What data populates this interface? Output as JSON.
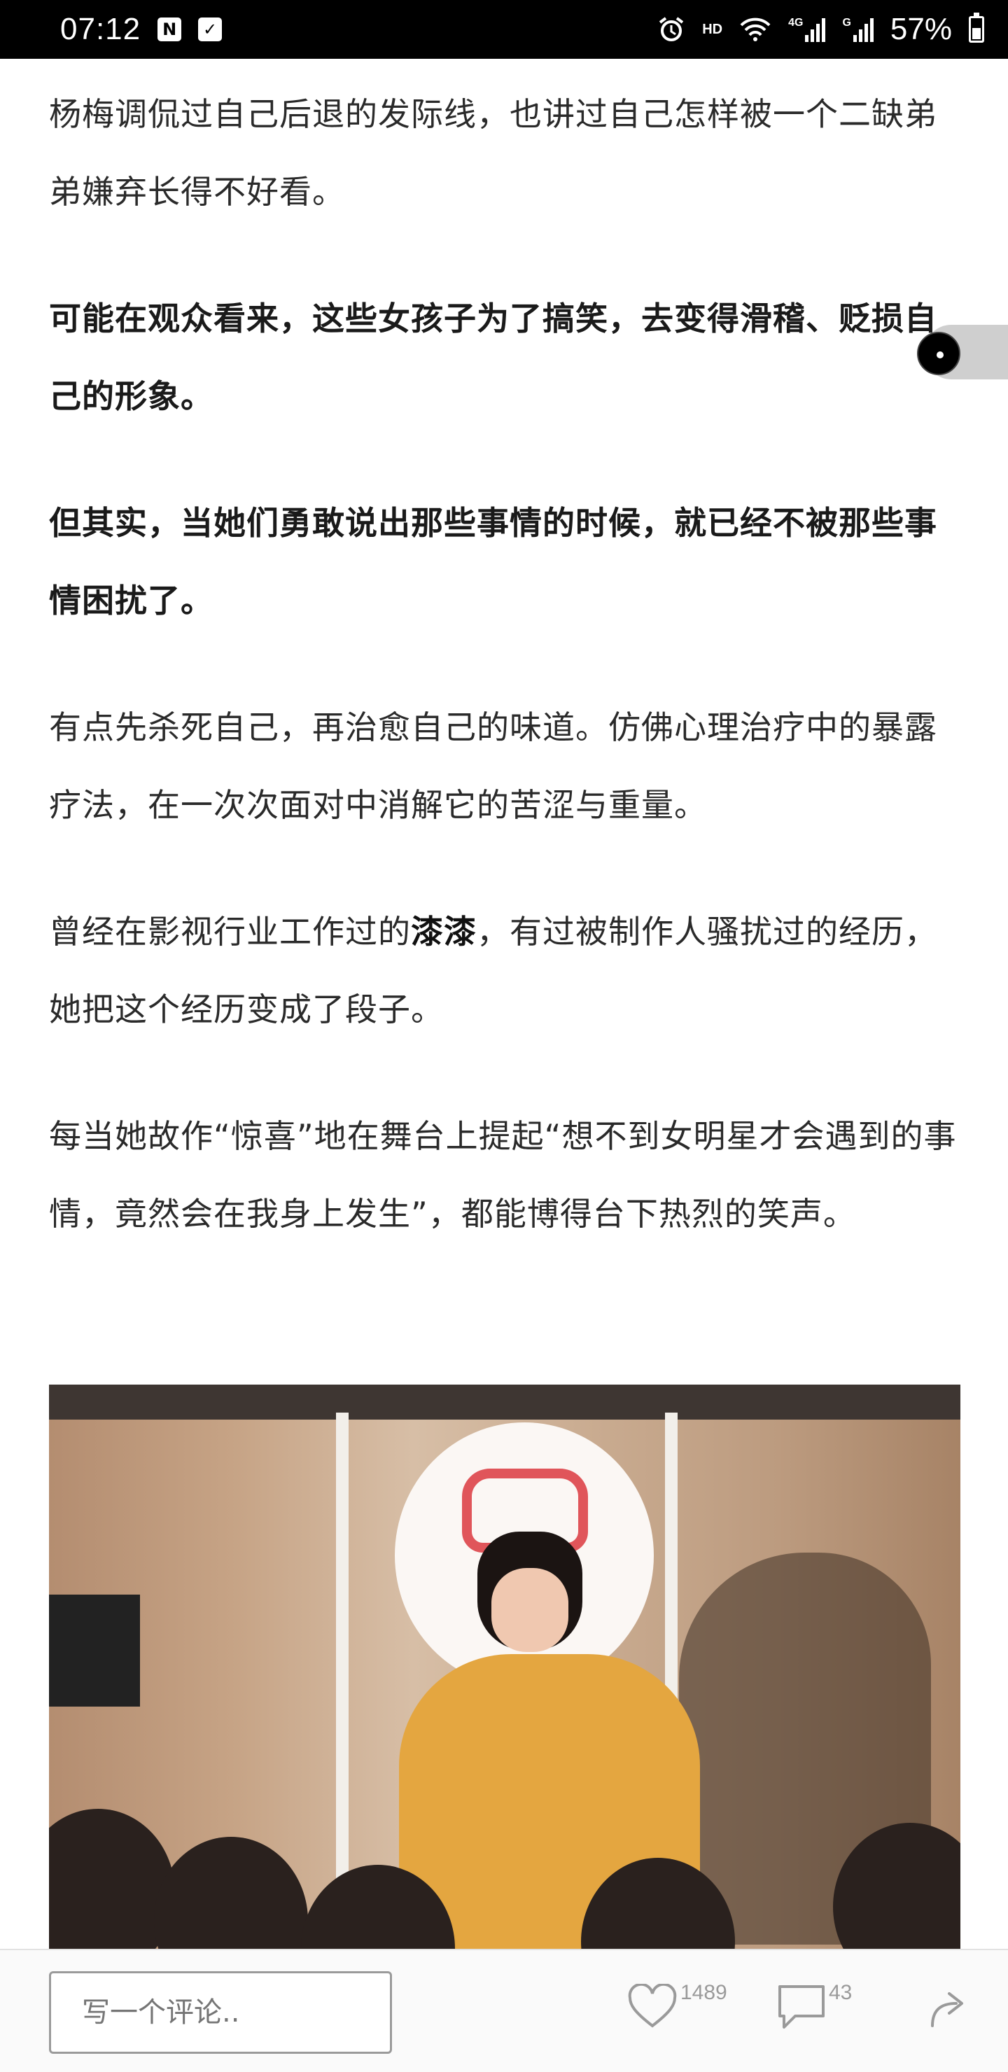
{
  "status_bar": {
    "time": "07:12",
    "left_icons": [
      "n-notification-icon",
      "check-notification-icon"
    ],
    "hd_label": "HD",
    "net_4g_label": "4G",
    "net_g_label": "G",
    "battery_text": "57%",
    "battery_level": 0.57
  },
  "article": {
    "paragraphs": [
      "杨梅调侃过自己后退的发际线，也讲过自己怎样被一个二缺弟弟嫌弃长得不好看。",
      "可能在观众看来，这些女孩子为了搞笑，去变得滑稽、贬损自己的形象。",
      "但其实，当她们勇敢说出那些事情的时候，就已经不被那些事情困扰了。",
      "有点先杀死自己，再治愈自己的味道。仿佛心理治疗中的暴露疗法，在一次次面对中消解它的苦涩与重量。",
      {
        "before": "曾经在影视行业工作过的",
        "bold": "漆漆",
        "after": "，有过被制作人骚扰过的经历，她把这个经历变成了段子。"
      },
      "每当她故作“惊喜”地在舞台上提起“想不到女明星才会遇到的事情，竟然会在我身上发生”，都能博得台下热烈的笑声。"
    ]
  },
  "bottom_bar": {
    "comment_placeholder": "写一个评论..",
    "like_count": "1489",
    "comment_count": "43"
  },
  "icons": {
    "like": "heart-icon",
    "comment": "speech-bubble-icon",
    "share": "share-arrow-icon",
    "alarm": "alarm-icon",
    "wifi": "wifi-icon",
    "signal": "signal-icon",
    "battery": "battery-icon"
  }
}
